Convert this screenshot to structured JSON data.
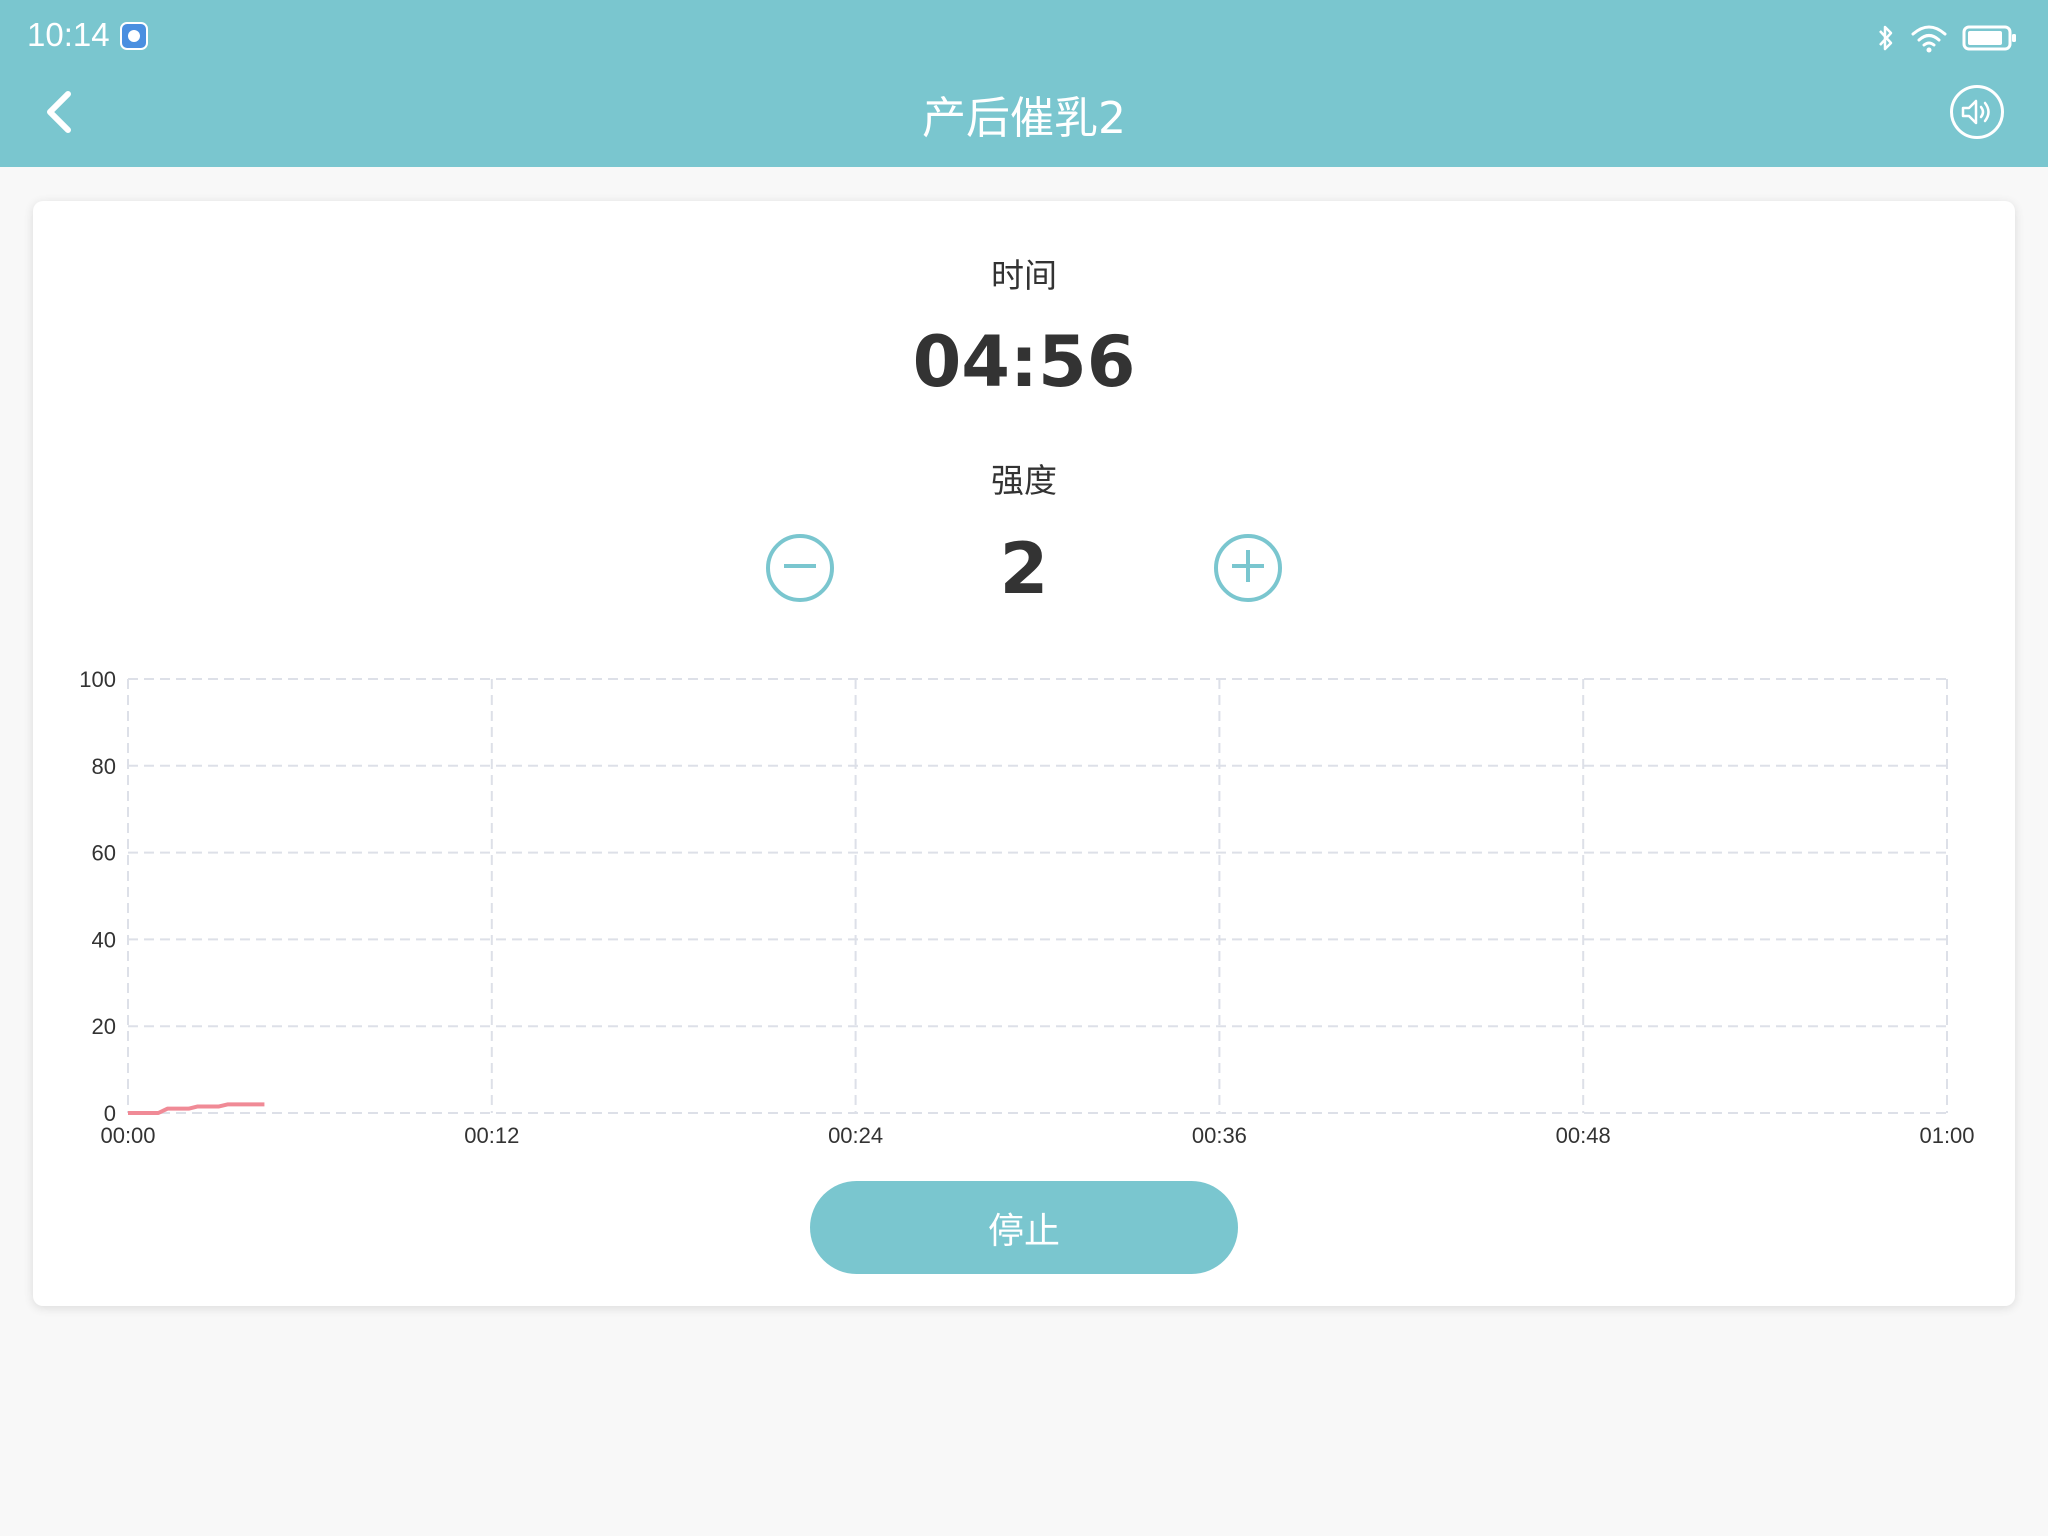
{
  "status_bar": {
    "time": "10:14",
    "icons": [
      "app-icon",
      "bluetooth-icon",
      "wifi-icon",
      "battery-icon"
    ]
  },
  "header": {
    "title": "产后催乳2",
    "back_icon": "chevron-left-icon",
    "sound_icon": "speaker-icon"
  },
  "main": {
    "time_label": "时间",
    "time_value": "04:56",
    "strength_label": "强度",
    "strength_value": "2",
    "stop_label": "停止"
  },
  "colors": {
    "accent": "#7ac6cf",
    "line": "#f08a96",
    "grid": "#dde0e8",
    "text": "#333333"
  },
  "chart_data": {
    "type": "line",
    "x_tick_labels": [
      "00:00",
      "00:12",
      "00:24",
      "00:36",
      "00:48",
      "01:00"
    ],
    "y_tick_labels": [
      "0",
      "20",
      "40",
      "60",
      "80",
      "100"
    ],
    "xlim": [
      0,
      60
    ],
    "ylim": [
      0,
      100
    ],
    "grid": true,
    "series": [
      {
        "x": [
          0,
          1,
          1.3,
          2,
          2.3,
          3,
          3.3,
          4,
          4.5
        ],
        "values": [
          0,
          0,
          1,
          1,
          1.5,
          1.5,
          2,
          2,
          2
        ]
      }
    ]
  }
}
